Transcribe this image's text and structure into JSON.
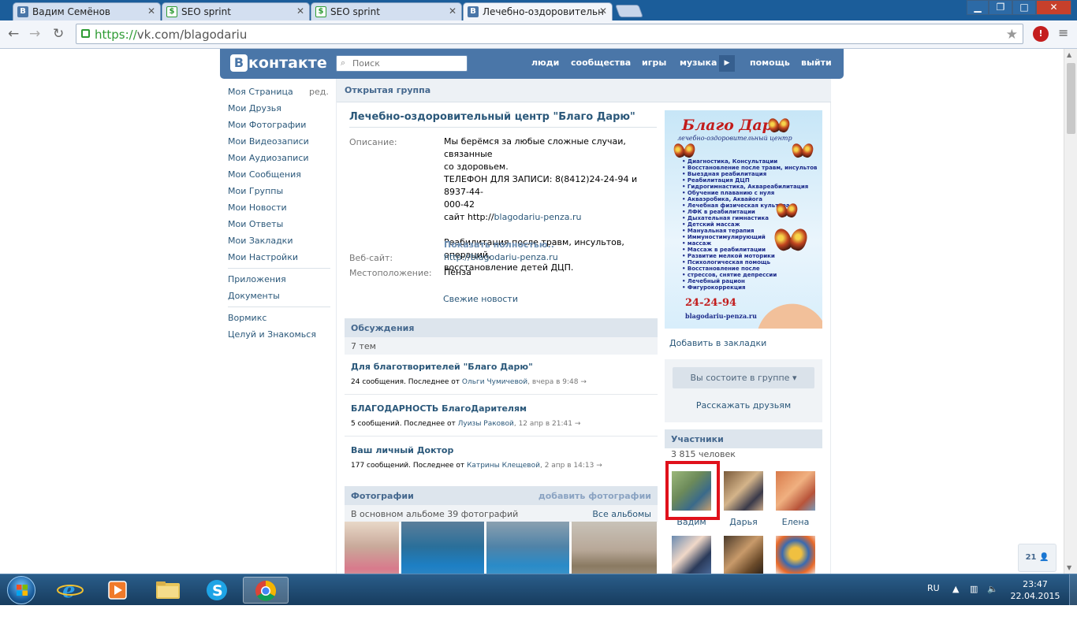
{
  "browser": {
    "tabs": [
      {
        "title": "Вадим Семёнов",
        "favicon": "vk-icon"
      },
      {
        "title": "SEO sprint",
        "favicon": "seosprint-icon"
      },
      {
        "title": "SEO sprint",
        "favicon": "seosprint-icon"
      },
      {
        "title": "Лечебно-оздоровительн",
        "favicon": "vk-icon",
        "active": true
      }
    ],
    "url_scheme": "https://",
    "url_rest": "vk.com/blagodariu",
    "window_controls": [
      "minimize",
      "maximize",
      "close"
    ]
  },
  "vk": {
    "logo_text": "контакте",
    "logo_letter": "В",
    "search_placeholder": "Поиск",
    "topnav": [
      "люди",
      "сообщества",
      "игры",
      "музыка",
      "помощь",
      "выйти"
    ],
    "accent": "#4a76a8"
  },
  "leftmenu": {
    "edit": "ред.",
    "items": [
      "Моя Страница",
      "Мои Друзья",
      "Мои Фотографии",
      "Мои Видеозаписи",
      "Мои Аудиозаписи",
      "Мои Сообщения",
      "Мои Группы",
      "Мои Новости",
      "Мои Ответы",
      "Мои Закладки",
      "Мои Настройки"
    ],
    "items2": [
      "Приложения",
      "Документы"
    ],
    "items3": [
      "Вормикс",
      "Целуй и Знакомься"
    ]
  },
  "group": {
    "type_label": "Открытая группа",
    "name": "Лечебно-оздоровительный центр \"Благо Дарю\"",
    "desc_label": "Описание:",
    "desc_lines": [
      "Мы берёмся за любые сложные случаи, связанные",
      "со здоровьем.",
      "ТЕЛЕФОН ДЛЯ ЗАПИСИ: 8(8412)24-24-94 и 8937-44-",
      "000-42"
    ],
    "desc_site_prefix": "сайт http://",
    "desc_site_link": "blagodariu-penza.ru",
    "desc_lines2": [
      "Реабилитация после травм, инсультов, операций,",
      "восстановление детей ДЦП."
    ],
    "show_more": "Показать полностью..",
    "website_label": "Веб-сайт:",
    "website": "http://blagodariu-penza.ru",
    "location_label": "Местоположение:",
    "location": "Пенза",
    "fresh_news": "Свежие новости"
  },
  "discussions": {
    "title": "Обсуждения",
    "count": "7 тем",
    "items": [
      {
        "title": "Для благотворителей \"Благо Дарю\"",
        "info": "24 сообщения. Последнее от ",
        "author": "Ольги Чумичевой",
        "time": ", вчера в 9:48",
        "arrow": "→"
      },
      {
        "title": "БЛАГОДАРНОСТЬ БлагоДарителям",
        "info": "5 сообщений. Последнее от ",
        "author": "Луизы Раковой",
        "time": ", 12 апр в 21:41",
        "arrow": "→"
      },
      {
        "title": "Ваш личный Доктор",
        "info": "177 сообщений. Последнее от ",
        "author": "Катрины Клещевой",
        "time": ", 2 апр в 14:13",
        "arrow": "→"
      }
    ]
  },
  "photos": {
    "title": "Фотографии",
    "add": "добавить фотографии",
    "album_info": "В основном альбоме 39 фотографий",
    "all_albums": "Все альбомы"
  },
  "poster": {
    "title": "Благо Дарю",
    "subtitle": "лечебно-оздоровительный центр",
    "services": [
      "Диагностика, Консультации",
      "Восстановление после травм, инсультов",
      "Выездная реабилитация",
      "Реабилитация ДЦП",
      "Гидрогимнастика, Аквареабилитация",
      "Обучение плаванию с нуля",
      "Акваэробика, Аквайога",
      "Лечебная физическая культура",
      "ЛФК в реабилитации",
      "Дыхательная гимнастика",
      "Детский массаж",
      "Мануальная терапия",
      "Иммуностимулирующий",
      "массаж",
      "Массаж в реабилитации",
      "Развитие мелкой моторики",
      "Психологическая помощь",
      "Восстановление после",
      "стрессов, снятие депрессии",
      "Лечебный рацион",
      "Фигурокоррекция"
    ],
    "phone": "24-24-94",
    "site": "blagodariu-penza.ru"
  },
  "sidebar": {
    "bookmark": "Добавить в закладки",
    "member_btn": "Вы состоите в группе",
    "tell_friends": "Расскажать друзьям",
    "members_title": "Участники",
    "members_count": "3 815 человек",
    "members": [
      "Вадим",
      "Дарья",
      "Елена"
    ]
  },
  "chat_count": "21",
  "taskbar": {
    "lang": "RU",
    "time": "23:47",
    "date": "22.04.2015",
    "apps": [
      "internet-explorer-icon",
      "media-player-icon",
      "file-explorer-icon",
      "skype-icon",
      "chrome-icon"
    ]
  }
}
